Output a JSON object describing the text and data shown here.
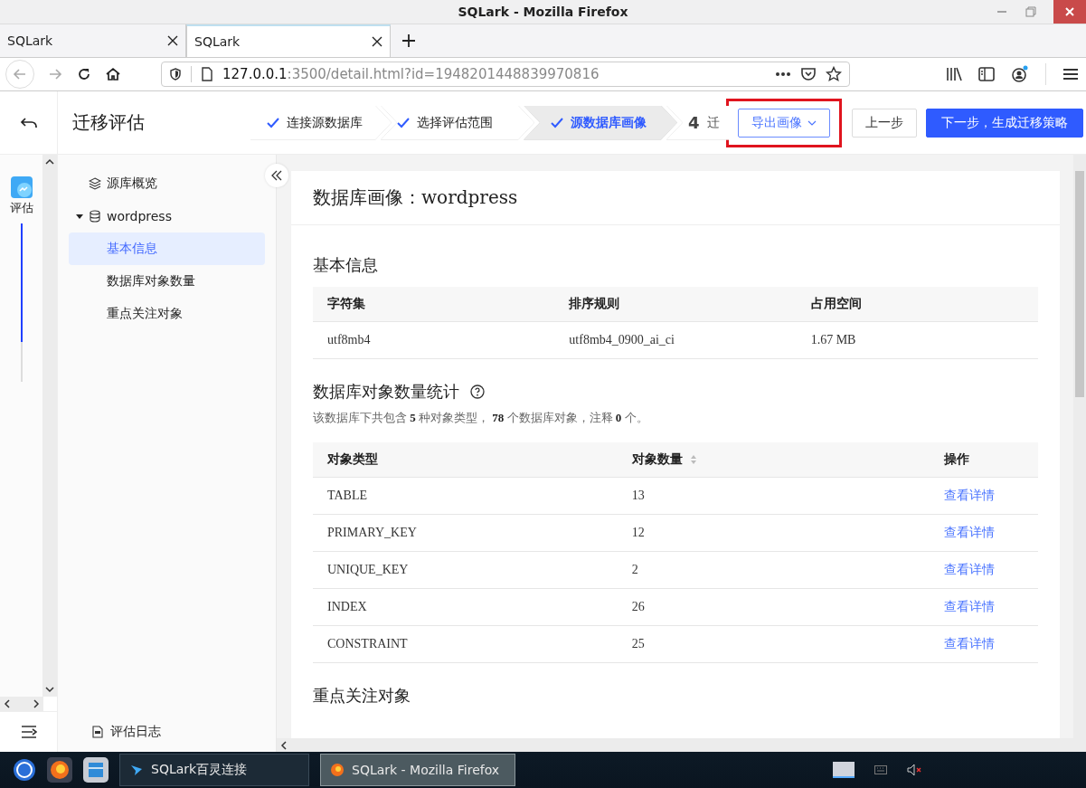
{
  "window": {
    "title": "SQLark - Mozilla Firefox"
  },
  "browser_tabs": [
    {
      "title": "SQLark",
      "selected": false
    },
    {
      "title": "SQLark",
      "selected": true
    }
  ],
  "address_bar": {
    "host": "127.0.0.1",
    "rest": ":3500/detail.html?id=1948201448839970816"
  },
  "app_header": {
    "title": "迁移评估",
    "steps": [
      {
        "label": "连接源数据库",
        "done": true,
        "selected": false
      },
      {
        "label": "选择评估范围",
        "done": true,
        "selected": false
      },
      {
        "label": "源数据库画像",
        "done": true,
        "selected": true
      },
      {
        "label": "迁",
        "number": "4",
        "done": false,
        "selected": false
      }
    ],
    "actions": [
      {
        "label": "导出画像",
        "kind": "dropdown",
        "highlighted": true
      },
      {
        "label": "上一步",
        "kind": "default",
        "highlighted": false
      },
      {
        "label": "下一步，生成迁移策略",
        "kind": "primary",
        "highlighted": false
      }
    ]
  },
  "rail": {
    "items": [
      {
        "label": "评估"
      }
    ],
    "level": 0.75
  },
  "sidebar": {
    "items": [
      {
        "label": "源库概览"
      },
      {
        "label": "wordpress",
        "expanded": true,
        "children": [
          {
            "label": "基本信息",
            "selected": true
          },
          {
            "label": "数据库对象数量",
            "selected": false
          },
          {
            "label": "重点关注对象",
            "selected": false
          }
        ]
      }
    ],
    "footer": {
      "label": "评估日志"
    }
  },
  "page": {
    "title": "数据库画像：wordpress",
    "sections": [
      {
        "kind": "table",
        "title": "基本信息",
        "columns": [
          {
            "label": "字符集",
            "sortable": false
          },
          {
            "label": "排序规则",
            "sortable": false
          },
          {
            "label": "占用空间",
            "sortable": false
          }
        ],
        "rows": [
          [
            "utf8mb4",
            "utf8mb4_0900_ai_ci",
            "1.67 MB"
          ]
        ]
      },
      {
        "kind": "table",
        "title": "数据库对象数量统计",
        "help": true,
        "summary": "该数据库下共包含 **5** 种对象类型， **78** 个数据库对象，注释 **0** 个。",
        "columns": [
          {
            "label": "对象类型",
            "sortable": false
          },
          {
            "label": "对象数量",
            "sortable": true
          },
          {
            "label": "操作",
            "sortable": false
          }
        ],
        "rows": [
          [
            "TABLE",
            "13",
            "查看详情"
          ],
          [
            "PRIMARY_KEY",
            "12",
            "查看详情"
          ],
          [
            "UNIQUE_KEY",
            "2",
            "查看详情"
          ],
          [
            "INDEX",
            "26",
            "查看详情"
          ],
          [
            "CONSTRAINT",
            "25",
            "查看详情"
          ]
        ]
      },
      {
        "kind": "heading",
        "title": "重点关注对象"
      }
    ]
  },
  "taskbar": {
    "tasks": [
      {
        "label": "SQLark百灵连接",
        "selected": false
      },
      {
        "label": "SQLark - Mozilla Firefox",
        "selected": true
      }
    ]
  }
}
